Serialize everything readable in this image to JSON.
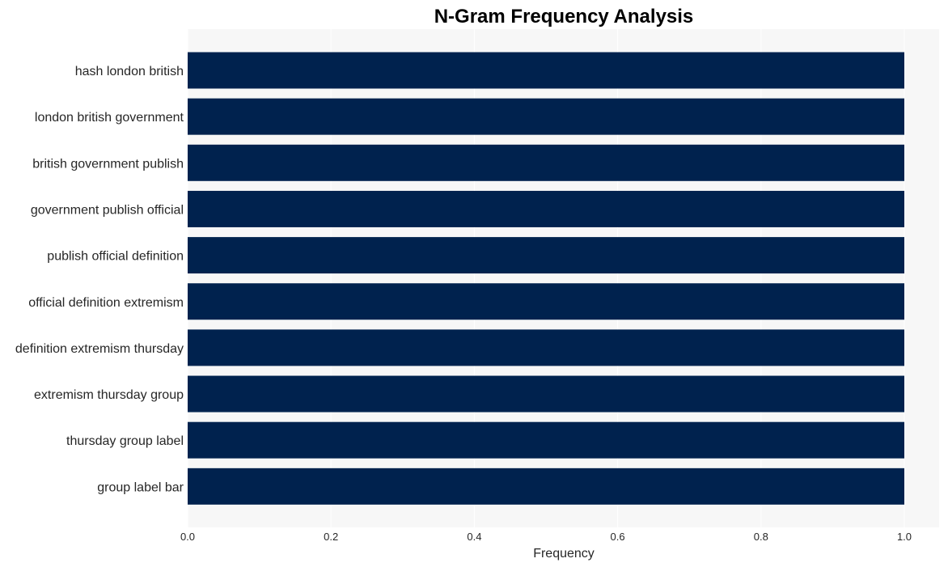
{
  "chart_data": {
    "type": "bar",
    "orientation": "horizontal",
    "title": "N-Gram Frequency Analysis",
    "xlabel": "Frequency",
    "ylabel": "",
    "categories": [
      "hash london british",
      "london british government",
      "british government publish",
      "government publish official",
      "publish official definition",
      "official definition extremism",
      "definition extremism thursday",
      "extremism thursday group",
      "thursday group label",
      "group label bar"
    ],
    "values": [
      1,
      1,
      1,
      1,
      1,
      1,
      1,
      1,
      1,
      1
    ],
    "xlim": [
      0,
      1.05
    ],
    "xticks": [
      0.0,
      0.2,
      0.4,
      0.6,
      0.8,
      1.0
    ],
    "xtick_labels": [
      "0.0",
      "0.2",
      "0.4",
      "0.6",
      "0.8",
      "1.0"
    ],
    "grid": true,
    "legend": "none",
    "colors": {
      "bar": "#00224e",
      "plot_background": "#f7f7f7",
      "grid": "#ffffff"
    }
  }
}
